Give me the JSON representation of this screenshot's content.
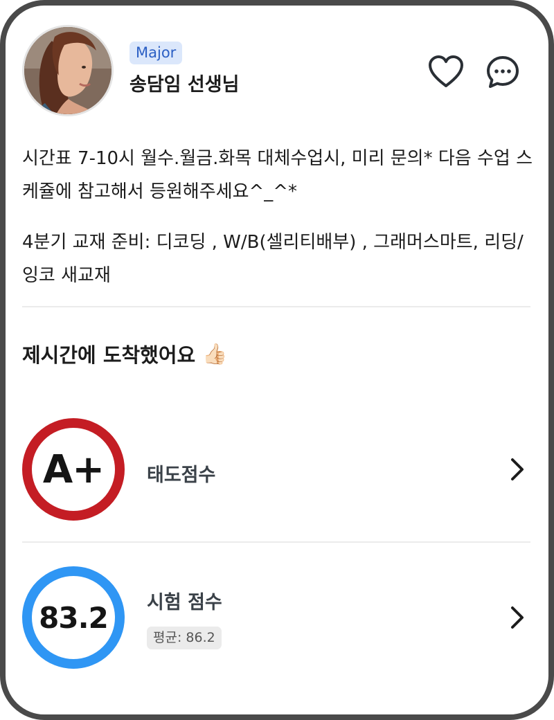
{
  "teacher": {
    "badge": "Major",
    "name": "송담임 선생님",
    "avatar_icon": "teacher-photo"
  },
  "header_actions": {
    "like_icon": "heart-icon",
    "message_icon": "chat-bubble-icon"
  },
  "notice": {
    "paragraph1": "시간표 7-10시 월수.월금.화목 대체수업시, 미리 문의* 다음 수업 스케쥴에 참고해서 등원해주세요^_^*",
    "paragraph2": "4분기 교재 준비: 디코딩 , W/B(셀리티배부) , 그래머스마트, 리딩/잉코 새교재"
  },
  "status": {
    "title": "제시간에 도착했어요",
    "emoji": "👍🏻"
  },
  "scores": {
    "attitude": {
      "grade": "A+",
      "label": "태도점수",
      "ring_color": "#c41d24"
    },
    "exam": {
      "value": "83.2",
      "label": "시험 점수",
      "average": "평균: 86.2",
      "ring_color": "#2f96f4"
    }
  },
  "colors": {
    "badge_bg": "#dbe7fb",
    "badge_text": "#2b5fc4",
    "frame": "#4a4a4a"
  }
}
